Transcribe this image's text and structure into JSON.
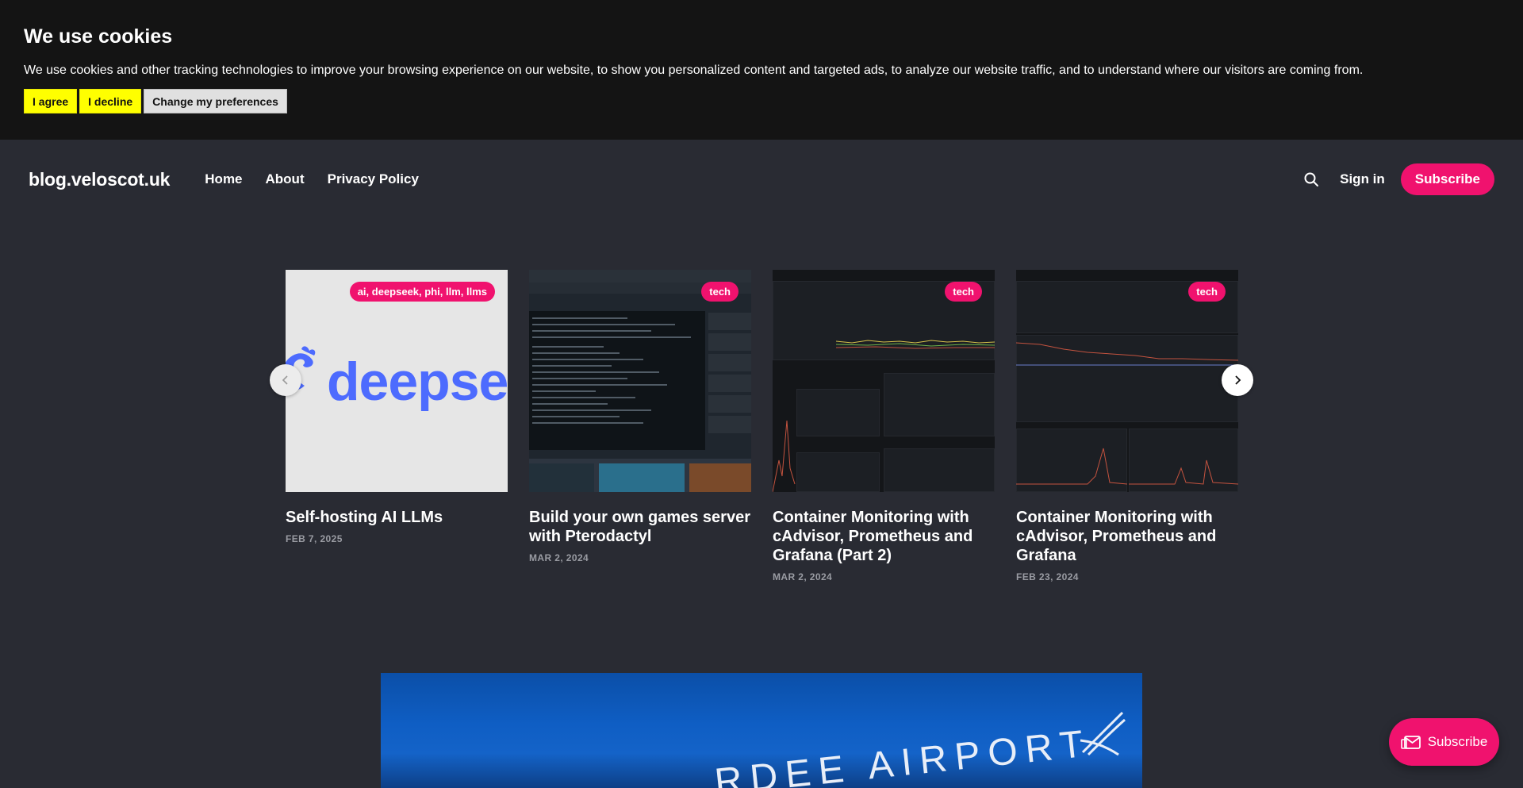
{
  "cookie": {
    "title": "We use cookies",
    "text": "We use cookies and other tracking technologies to improve your browsing experience on our website, to show you personalized content and targeted ads, to analyze our website traffic, and to understand where our visitors are coming from.",
    "agree_label": "I agree",
    "decline_label": "I decline",
    "preferences_label": "Change my preferences"
  },
  "header": {
    "logo": "blog.veloscot.uk",
    "nav": [
      "Home",
      "About",
      "Privacy Policy"
    ],
    "signin_label": "Sign in",
    "subscribe_label": "Subscribe"
  },
  "posts": [
    {
      "title": "Self-hosting AI LLMs",
      "date": "FEB 7, 2025",
      "tag": "ai, deepseek, phi, llm, llms",
      "image_text": "deepse"
    },
    {
      "title": "Build your own games server with Pterodactyl",
      "date": "MAR 2, 2024",
      "tag": "tech"
    },
    {
      "title": "Container Monitoring with cAdvisor, Prometheus and Grafana (Part 2)",
      "date": "MAR 2, 2024",
      "tag": "tech"
    },
    {
      "title": "Container Monitoring with cAdvisor, Prometheus and Grafana",
      "date": "FEB 23, 2024",
      "tag": "tech"
    }
  ],
  "hero": {
    "image_text": "RDEE AIRPORT"
  },
  "floating_subscribe_label": "Subscribe",
  "colors": {
    "accent": "#f0126e",
    "background": "#292b33",
    "cookie_bg": "#141414",
    "cookie_button": "#ffff00"
  }
}
